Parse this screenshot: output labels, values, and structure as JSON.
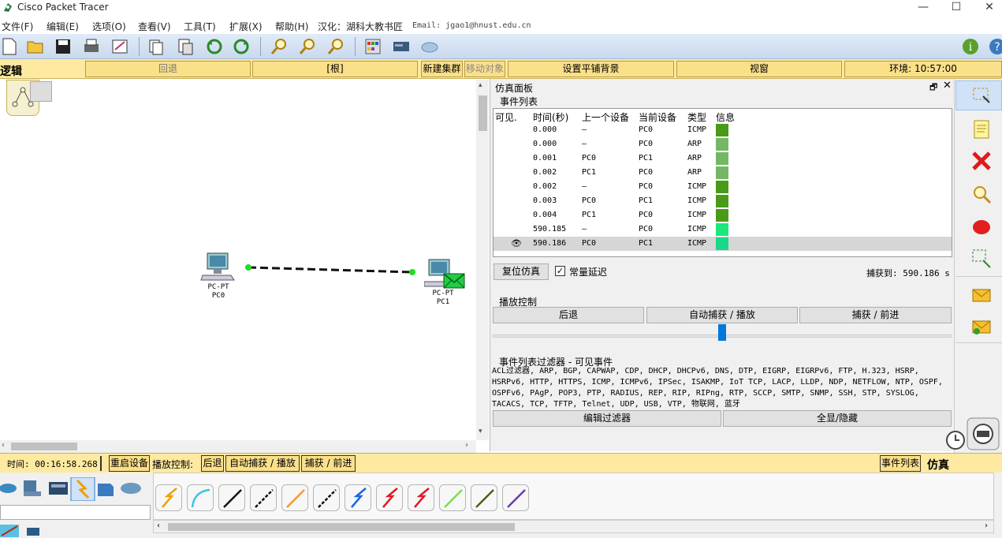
{
  "window": {
    "title": "Cisco Packet Tracer",
    "minimize": "—",
    "maximize": "☐",
    "close": "✕"
  },
  "menu": [
    {
      "label": "文件(F)"
    },
    {
      "label": "编辑(E)"
    },
    {
      "label": "选项(O)"
    },
    {
      "label": "查看(V)"
    },
    {
      "label": "工具(T)"
    },
    {
      "label": "扩展(X)"
    },
    {
      "label": "帮助(H)"
    },
    {
      "label": "汉化：湖科大教书匠"
    }
  ],
  "menu_email": "Email: jgao1@hnust.edu.cn",
  "logicbar": {
    "mode": "逻辑",
    "back": "回退",
    "root": "[根]",
    "new_cluster": "新建集群",
    "move_object": "移动对象",
    "set_background": "设置平铺背景",
    "viewport": "视窗",
    "environment": "环境: 10:57:00"
  },
  "devices": [
    {
      "type": "PC-PT",
      "name": "PC0"
    },
    {
      "type": "PC-PT",
      "name": "PC1"
    }
  ],
  "sim": {
    "panel_title": "仿真面板",
    "event_list_label": "事件列表",
    "columns": {
      "visible": "可见.",
      "time": "时间(秒)",
      "last": "上一个设备",
      "at": "当前设备",
      "type": "类型",
      "info": "信息"
    },
    "events": [
      {
        "time": "0.000",
        "last": "—",
        "at": "PC0",
        "type": "ICMP",
        "color": "#4a9a1a"
      },
      {
        "time": "0.000",
        "last": "—",
        "at": "PC0",
        "type": "ARP",
        "color": "#74b865"
      },
      {
        "time": "0.001",
        "last": "PC0",
        "at": "PC1",
        "type": "ARP",
        "color": "#74b865"
      },
      {
        "time": "0.002",
        "last": "PC1",
        "at": "PC0",
        "type": "ARP",
        "color": "#74b865"
      },
      {
        "time": "0.002",
        "last": "—",
        "at": "PC0",
        "type": "ICMP",
        "color": "#4a9a1a"
      },
      {
        "time": "0.003",
        "last": "PC0",
        "at": "PC1",
        "type": "ICMP",
        "color": "#4a9a1a"
      },
      {
        "time": "0.004",
        "last": "PC1",
        "at": "PC0",
        "type": "ICMP",
        "color": "#4a9a1a"
      },
      {
        "time": "590.185",
        "last": "—",
        "at": "PC0",
        "type": "ICMP",
        "color": "#19e87a"
      },
      {
        "time": "590.186",
        "last": "PC0",
        "at": "PC1",
        "type": "ICMP",
        "color": "#19d88a"
      }
    ],
    "reset": "复位仿真",
    "constant_delay": "常量延迟",
    "captured_to": "捕获到: 590.186 s",
    "play_controls_label": "播放控制",
    "back": "后退",
    "auto_capture": "自动捕获 / 播放",
    "capture_forward": "捕获 / 前进",
    "filter_label": "事件列表过滤器 - 可见事件",
    "filters": [
      "ACL过滤器, ARP, BGP, CAPWAP, CDP, DHCP, DHCPv6, DNS, DTP, EIGRP, EIGRPv6, FTP, H.323, HSRP,",
      "HSRPv6, HTTP, HTTPS, ICMP, ICMPv6, IPSec, ISAKMP, IoT TCP, LACP, LLDP, NDP, NETFLOW, NTP, OSPF,",
      "OSPFv6, PAgP, POP3, PTP, RADIUS, REP, RIP, RIPng, RTP, SCCP, SMTP, SNMP, SSH, STP, SYSLOG,",
      "TACACS, TCP, TFTP, Telnet, UDP, USB, VTP, 物联网, 蓝牙"
    ],
    "edit_filters": "编辑过滤器",
    "show_all": "全显/隐藏"
  },
  "statusbar": {
    "time": "时间: 00:16:58.268",
    "restart": "重启设备",
    "play_label": "播放控制:",
    "back": "后退",
    "auto": "自动捕获 / 播放",
    "forward": "捕获 / 前进",
    "event_list": "事件列表",
    "simulation": "仿真"
  },
  "cables": [
    {
      "name": "auto-connection",
      "color": "#f0a000"
    },
    {
      "name": "console",
      "color": "#3bc4e0"
    },
    {
      "name": "copper-straight",
      "color": "#111111"
    },
    {
      "name": "copper-cross",
      "color": "#111111"
    },
    {
      "name": "fiber",
      "color": "#f59a2a"
    },
    {
      "name": "phone",
      "color": "#111111"
    },
    {
      "name": "coaxial",
      "color": "#1a66e0"
    },
    {
      "name": "serial-dce",
      "color": "#e01a2a"
    },
    {
      "name": "serial-dte",
      "color": "#e01a2a"
    },
    {
      "name": "octal",
      "color": "#7ae04a"
    },
    {
      "name": "iot",
      "color": "#5a5a1a"
    },
    {
      "name": "usb",
      "color": "#6a3ab0"
    }
  ]
}
